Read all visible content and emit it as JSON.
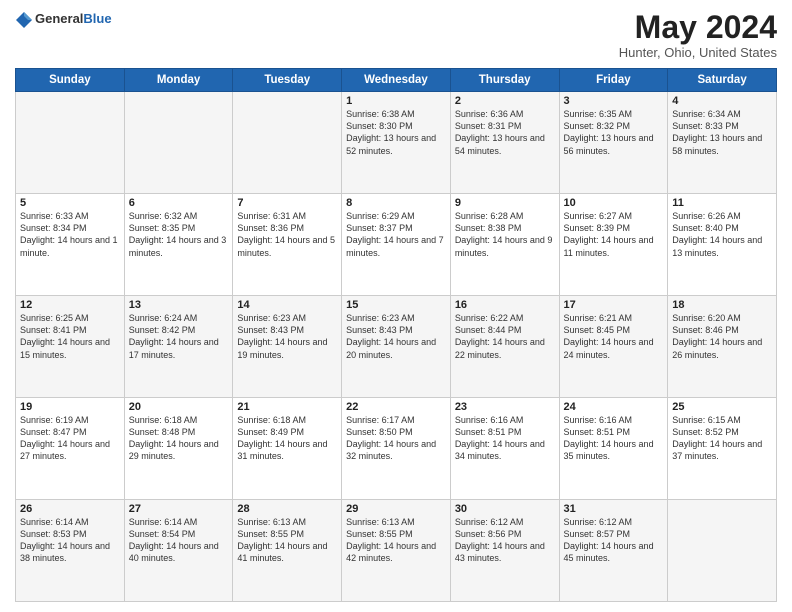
{
  "header": {
    "logo_general": "General",
    "logo_blue": "Blue",
    "title": "May 2024",
    "location": "Hunter, Ohio, United States"
  },
  "weekdays": [
    "Sunday",
    "Monday",
    "Tuesday",
    "Wednesday",
    "Thursday",
    "Friday",
    "Saturday"
  ],
  "weeks": [
    [
      {
        "day": "",
        "sunrise": "",
        "sunset": "",
        "daylight": ""
      },
      {
        "day": "",
        "sunrise": "",
        "sunset": "",
        "daylight": ""
      },
      {
        "day": "",
        "sunrise": "",
        "sunset": "",
        "daylight": ""
      },
      {
        "day": "1",
        "sunrise": "Sunrise: 6:38 AM",
        "sunset": "Sunset: 8:30 PM",
        "daylight": "Daylight: 13 hours and 52 minutes."
      },
      {
        "day": "2",
        "sunrise": "Sunrise: 6:36 AM",
        "sunset": "Sunset: 8:31 PM",
        "daylight": "Daylight: 13 hours and 54 minutes."
      },
      {
        "day": "3",
        "sunrise": "Sunrise: 6:35 AM",
        "sunset": "Sunset: 8:32 PM",
        "daylight": "Daylight: 13 hours and 56 minutes."
      },
      {
        "day": "4",
        "sunrise": "Sunrise: 6:34 AM",
        "sunset": "Sunset: 8:33 PM",
        "daylight": "Daylight: 13 hours and 58 minutes."
      }
    ],
    [
      {
        "day": "5",
        "sunrise": "Sunrise: 6:33 AM",
        "sunset": "Sunset: 8:34 PM",
        "daylight": "Daylight: 14 hours and 1 minute."
      },
      {
        "day": "6",
        "sunrise": "Sunrise: 6:32 AM",
        "sunset": "Sunset: 8:35 PM",
        "daylight": "Daylight: 14 hours and 3 minutes."
      },
      {
        "day": "7",
        "sunrise": "Sunrise: 6:31 AM",
        "sunset": "Sunset: 8:36 PM",
        "daylight": "Daylight: 14 hours and 5 minutes."
      },
      {
        "day": "8",
        "sunrise": "Sunrise: 6:29 AM",
        "sunset": "Sunset: 8:37 PM",
        "daylight": "Daylight: 14 hours and 7 minutes."
      },
      {
        "day": "9",
        "sunrise": "Sunrise: 6:28 AM",
        "sunset": "Sunset: 8:38 PM",
        "daylight": "Daylight: 14 hours and 9 minutes."
      },
      {
        "day": "10",
        "sunrise": "Sunrise: 6:27 AM",
        "sunset": "Sunset: 8:39 PM",
        "daylight": "Daylight: 14 hours and 11 minutes."
      },
      {
        "day": "11",
        "sunrise": "Sunrise: 6:26 AM",
        "sunset": "Sunset: 8:40 PM",
        "daylight": "Daylight: 14 hours and 13 minutes."
      }
    ],
    [
      {
        "day": "12",
        "sunrise": "Sunrise: 6:25 AM",
        "sunset": "Sunset: 8:41 PM",
        "daylight": "Daylight: 14 hours and 15 minutes."
      },
      {
        "day": "13",
        "sunrise": "Sunrise: 6:24 AM",
        "sunset": "Sunset: 8:42 PM",
        "daylight": "Daylight: 14 hours and 17 minutes."
      },
      {
        "day": "14",
        "sunrise": "Sunrise: 6:23 AM",
        "sunset": "Sunset: 8:43 PM",
        "daylight": "Daylight: 14 hours and 19 minutes."
      },
      {
        "day": "15",
        "sunrise": "Sunrise: 6:23 AM",
        "sunset": "Sunset: 8:43 PM",
        "daylight": "Daylight: 14 hours and 20 minutes."
      },
      {
        "day": "16",
        "sunrise": "Sunrise: 6:22 AM",
        "sunset": "Sunset: 8:44 PM",
        "daylight": "Daylight: 14 hours and 22 minutes."
      },
      {
        "day": "17",
        "sunrise": "Sunrise: 6:21 AM",
        "sunset": "Sunset: 8:45 PM",
        "daylight": "Daylight: 14 hours and 24 minutes."
      },
      {
        "day": "18",
        "sunrise": "Sunrise: 6:20 AM",
        "sunset": "Sunset: 8:46 PM",
        "daylight": "Daylight: 14 hours and 26 minutes."
      }
    ],
    [
      {
        "day": "19",
        "sunrise": "Sunrise: 6:19 AM",
        "sunset": "Sunset: 8:47 PM",
        "daylight": "Daylight: 14 hours and 27 minutes."
      },
      {
        "day": "20",
        "sunrise": "Sunrise: 6:18 AM",
        "sunset": "Sunset: 8:48 PM",
        "daylight": "Daylight: 14 hours and 29 minutes."
      },
      {
        "day": "21",
        "sunrise": "Sunrise: 6:18 AM",
        "sunset": "Sunset: 8:49 PM",
        "daylight": "Daylight: 14 hours and 31 minutes."
      },
      {
        "day": "22",
        "sunrise": "Sunrise: 6:17 AM",
        "sunset": "Sunset: 8:50 PM",
        "daylight": "Daylight: 14 hours and 32 minutes."
      },
      {
        "day": "23",
        "sunrise": "Sunrise: 6:16 AM",
        "sunset": "Sunset: 8:51 PM",
        "daylight": "Daylight: 14 hours and 34 minutes."
      },
      {
        "day": "24",
        "sunrise": "Sunrise: 6:16 AM",
        "sunset": "Sunset: 8:51 PM",
        "daylight": "Daylight: 14 hours and 35 minutes."
      },
      {
        "day": "25",
        "sunrise": "Sunrise: 6:15 AM",
        "sunset": "Sunset: 8:52 PM",
        "daylight": "Daylight: 14 hours and 37 minutes."
      }
    ],
    [
      {
        "day": "26",
        "sunrise": "Sunrise: 6:14 AM",
        "sunset": "Sunset: 8:53 PM",
        "daylight": "Daylight: 14 hours and 38 minutes."
      },
      {
        "day": "27",
        "sunrise": "Sunrise: 6:14 AM",
        "sunset": "Sunset: 8:54 PM",
        "daylight": "Daylight: 14 hours and 40 minutes."
      },
      {
        "day": "28",
        "sunrise": "Sunrise: 6:13 AM",
        "sunset": "Sunset: 8:55 PM",
        "daylight": "Daylight: 14 hours and 41 minutes."
      },
      {
        "day": "29",
        "sunrise": "Sunrise: 6:13 AM",
        "sunset": "Sunset: 8:55 PM",
        "daylight": "Daylight: 14 hours and 42 minutes."
      },
      {
        "day": "30",
        "sunrise": "Sunrise: 6:12 AM",
        "sunset": "Sunset: 8:56 PM",
        "daylight": "Daylight: 14 hours and 43 minutes."
      },
      {
        "day": "31",
        "sunrise": "Sunrise: 6:12 AM",
        "sunset": "Sunset: 8:57 PM",
        "daylight": "Daylight: 14 hours and 45 minutes."
      },
      {
        "day": "",
        "sunrise": "",
        "sunset": "",
        "daylight": ""
      }
    ]
  ]
}
